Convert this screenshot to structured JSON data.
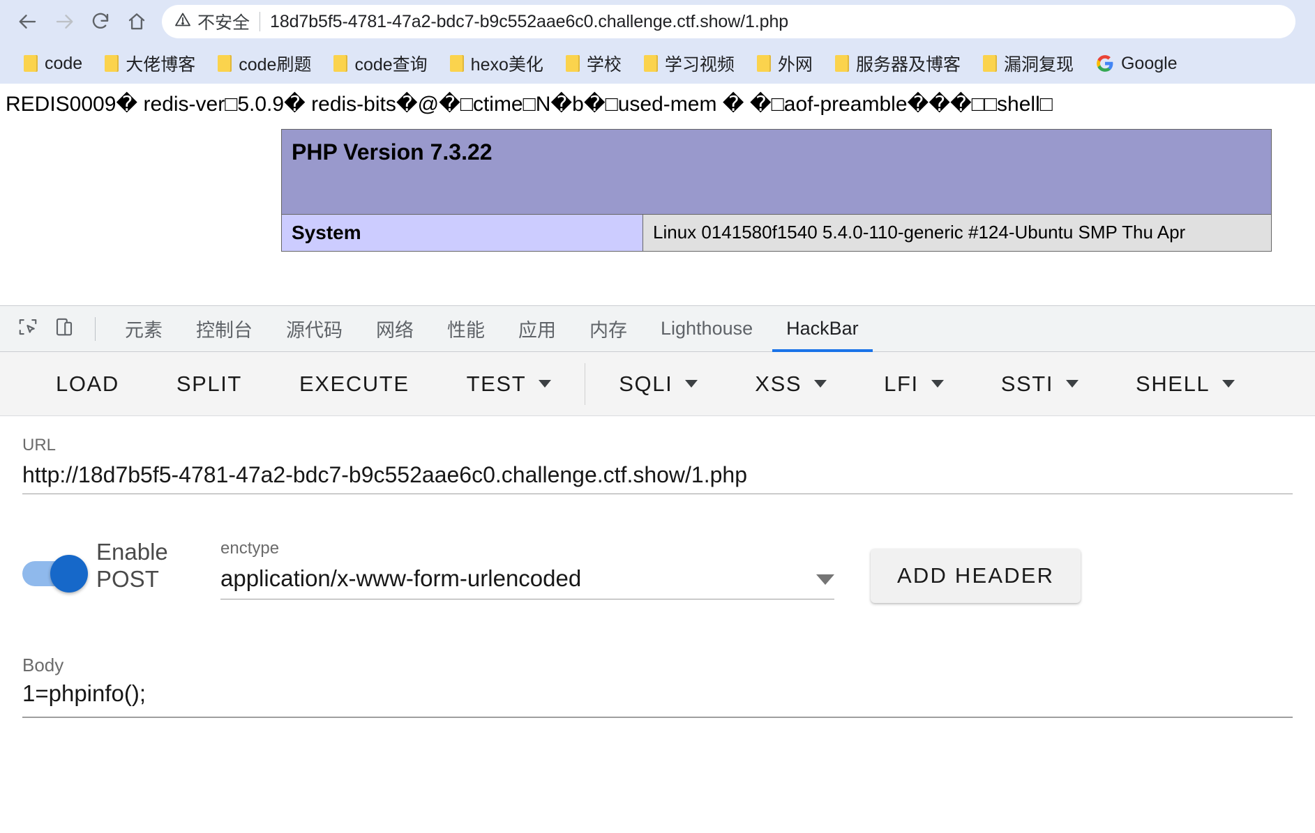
{
  "browser": {
    "nav": {
      "back_icon": "arrow-left-icon",
      "forward_icon": "arrow-right-icon",
      "reload_icon": "reload-icon",
      "home_icon": "home-icon"
    },
    "omnibox": {
      "security_icon": "warning-triangle-icon",
      "security_label": "不安全",
      "url": "18d7b5f5-4781-47a2-bdc7-b9c552aae6c0.challenge.ctf.show/1.php",
      "full_url": "http://18d7b5f5-4781-47a2-bdc7-b9c552aae6c0.challenge.ctf.show/1.php"
    },
    "bookmarks": [
      {
        "label": "code",
        "icon": "folder-icon"
      },
      {
        "label": "大佬博客",
        "icon": "folder-icon"
      },
      {
        "label": "code刷题",
        "icon": "folder-icon"
      },
      {
        "label": "code查询",
        "icon": "folder-icon"
      },
      {
        "label": "hexo美化",
        "icon": "folder-icon"
      },
      {
        "label": "学校",
        "icon": "folder-icon"
      },
      {
        "label": "学习视频",
        "icon": "folder-icon"
      },
      {
        "label": "外网",
        "icon": "folder-icon"
      },
      {
        "label": "服务器及博客",
        "icon": "folder-icon"
      },
      {
        "label": "漏洞复现",
        "icon": "folder-icon"
      },
      {
        "label": "Google",
        "icon": "google-g-icon"
      }
    ]
  },
  "page": {
    "redis_dump": "REDIS0009� redis-ver□5.0.9� redis-bits�@�□ctime□N�b�□used-mem � �□aof-preamble���□□shell□",
    "phpinfo": {
      "version_title": "PHP Version 7.3.22",
      "rows": [
        {
          "label": "System",
          "value": "Linux 0141580f1540 5.4.0-110-generic #124-Ubuntu SMP Thu Apr"
        }
      ]
    }
  },
  "devtools": {
    "inspect_icon": "cursor-select-icon",
    "device_toolbar_icon": "device-toggle-icon",
    "tabs": [
      {
        "label": "元素",
        "active": false
      },
      {
        "label": "控制台",
        "active": false
      },
      {
        "label": "源代码",
        "active": false
      },
      {
        "label": "网络",
        "active": false
      },
      {
        "label": "性能",
        "active": false
      },
      {
        "label": "应用",
        "active": false
      },
      {
        "label": "内存",
        "active": false
      },
      {
        "label": "Lighthouse",
        "active": false
      },
      {
        "label": "HackBar",
        "active": true
      }
    ],
    "active_tab_color": "#1a73e8"
  },
  "hackbar": {
    "toolbar": [
      {
        "label": "LOAD",
        "has_caret": false
      },
      {
        "label": "SPLIT",
        "has_caret": false
      },
      {
        "label": "EXECUTE",
        "has_caret": false
      },
      {
        "label": "TEST",
        "has_caret": true
      },
      {
        "label": "SQLI",
        "has_caret": true
      },
      {
        "label": "XSS",
        "has_caret": true
      },
      {
        "label": "LFI",
        "has_caret": true
      },
      {
        "label": "SSTI",
        "has_caret": true
      },
      {
        "label": "SHELL",
        "has_caret": true
      }
    ],
    "url_field": {
      "label": "URL",
      "value": "http://18d7b5f5-4781-47a2-bdc7-b9c552aae6c0.challenge.ctf.show/1.php"
    },
    "post_toggle": {
      "label": "Enable POST",
      "label_line1": "Enable",
      "label_line2": "POST",
      "enabled": true,
      "on_color": "#1668c9"
    },
    "enctype": {
      "label": "enctype",
      "value": "application/x-www-form-urlencoded",
      "caret_icon": "chevron-down-icon"
    },
    "add_header_label": "ADD HEADER",
    "body_field": {
      "label": "Body",
      "value": "1=phpinfo();"
    }
  }
}
